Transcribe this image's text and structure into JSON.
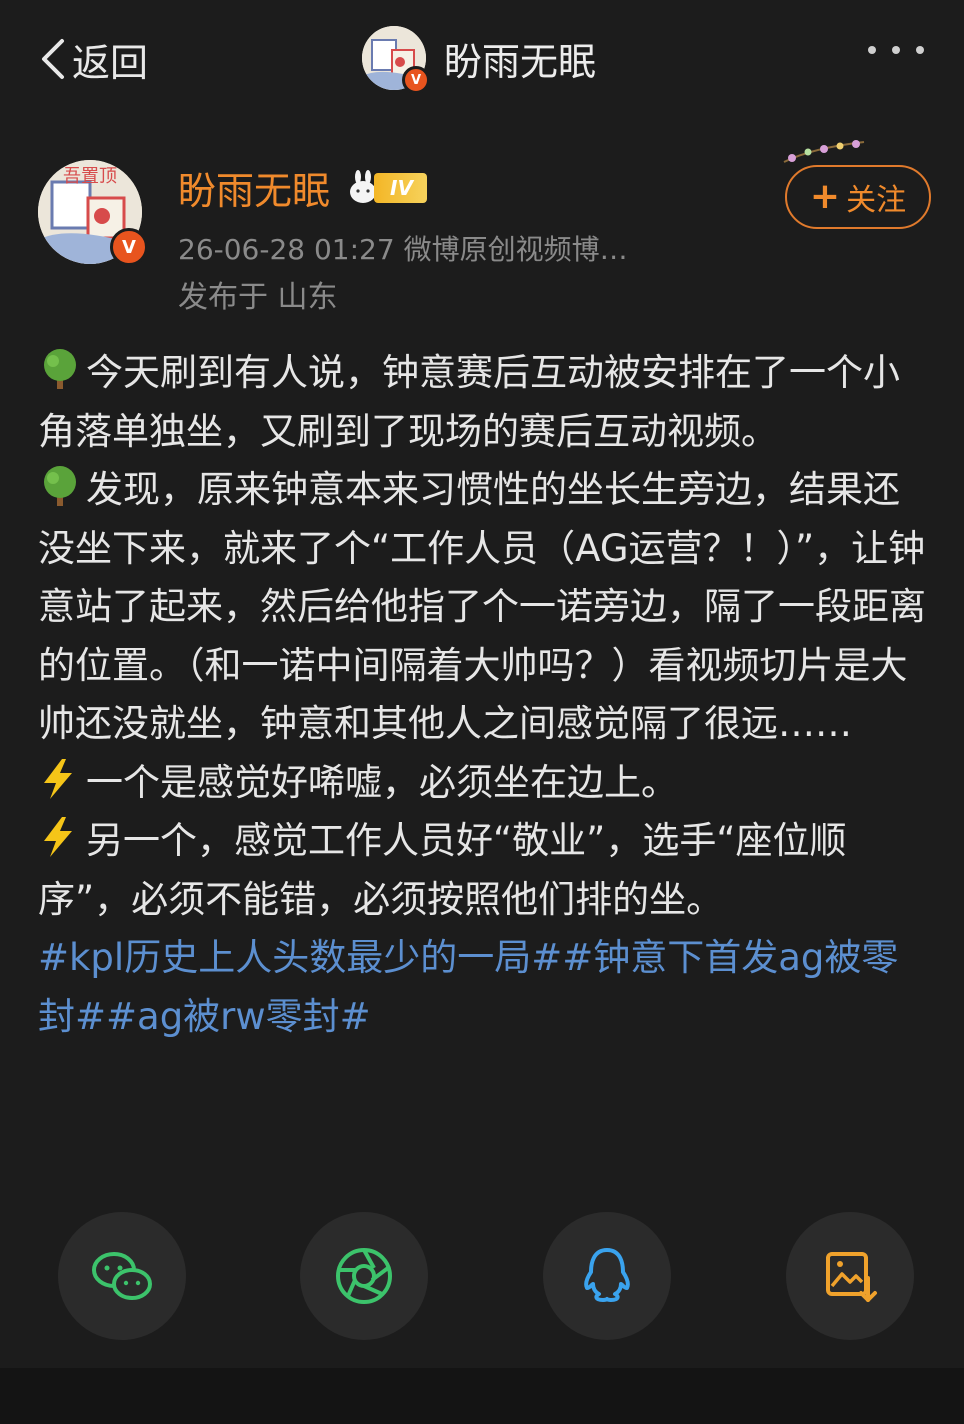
{
  "nav": {
    "back_label": "返回",
    "title": "盼雨无眠"
  },
  "post": {
    "author_name": "盼雨无眠",
    "level_badge": "IV",
    "meta": "26-06-28 01:27  微博原创视频博…",
    "location": "发布于 山东",
    "follow_label": "关注",
    "verified_mark": "V",
    "avatar_text": "吾置顶"
  },
  "content": {
    "p1": "今天刷到有人说，钟意赛后互动被安排在了一个小角落单独坐，又刷到了现场的赛后互动视频。",
    "p2": "发现，原来钟意本来习惯性的坐长生旁边，结果还没坐下来，就来了个“工作人员（AG运营？！）”，让钟意站了起来，然后给他指了个一诺旁边，隔了一段距离的位置。（和一诺中间隔着大帅吗？）看视频切片是大帅还没就坐，钟意和其他人之间感觉隔了很远……",
    "p3": "一个是感觉好唏嘘，必须坐在边上。",
    "p4": "另一个，感觉工作人员好“敬业”，选手“座位顺序”，必须不能错，必须按照他们排的坐。",
    "hashtags": [
      "#kpl历史上人头数最少的一局#",
      "#钟意下首发ag被零封#",
      "#ag被rw零封#"
    ]
  },
  "share": [
    {
      "name": "wechat-icon",
      "color": "#3cc36b"
    },
    {
      "name": "moments-icon",
      "color": "#3cc36b"
    },
    {
      "name": "qq-icon",
      "color": "#3aa3ee"
    },
    {
      "name": "save-image-icon",
      "color": "#f0a22c"
    }
  ]
}
